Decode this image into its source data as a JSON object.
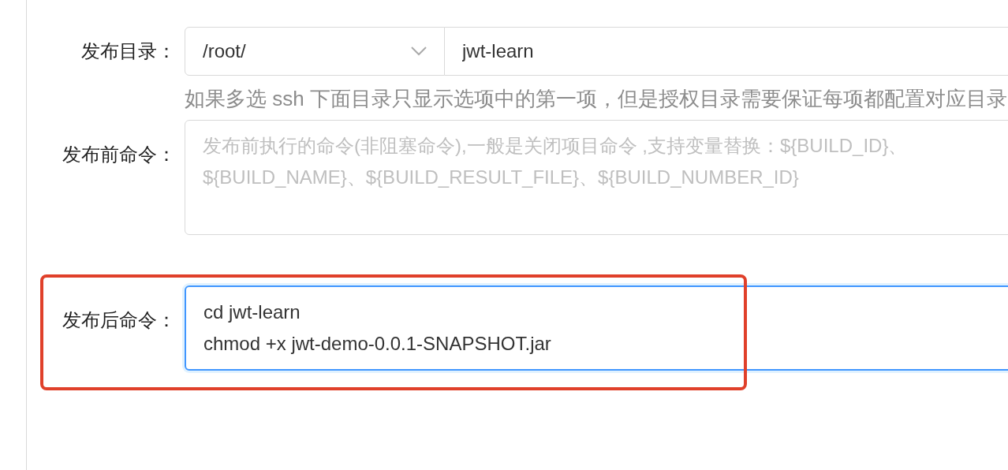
{
  "publish_directory": {
    "label": "发布目录：",
    "select_value": "/root/",
    "input_value": "jwt-learn",
    "hint": "如果多选 ssh 下面目录只显示选项中的第一项，但是授权目录需要保证每项都配置对应目录"
  },
  "pre_command": {
    "label": "发布前命令：",
    "placeholder": "发布前执行的命令(非阻塞命令),一般是关闭项目命令 ,支持变量替换：${BUILD_ID}、${BUILD_NAME}、${BUILD_RESULT_FILE}、${BUILD_NUMBER_ID}",
    "focused": false,
    "highlighted": false
  },
  "post_command": {
    "label": "发布后命令：",
    "value": "cd jwt-learn\nchmod +x jwt-demo-0.0.1-SNAPSHOT.jar",
    "focused": true,
    "highlighted": true
  }
}
